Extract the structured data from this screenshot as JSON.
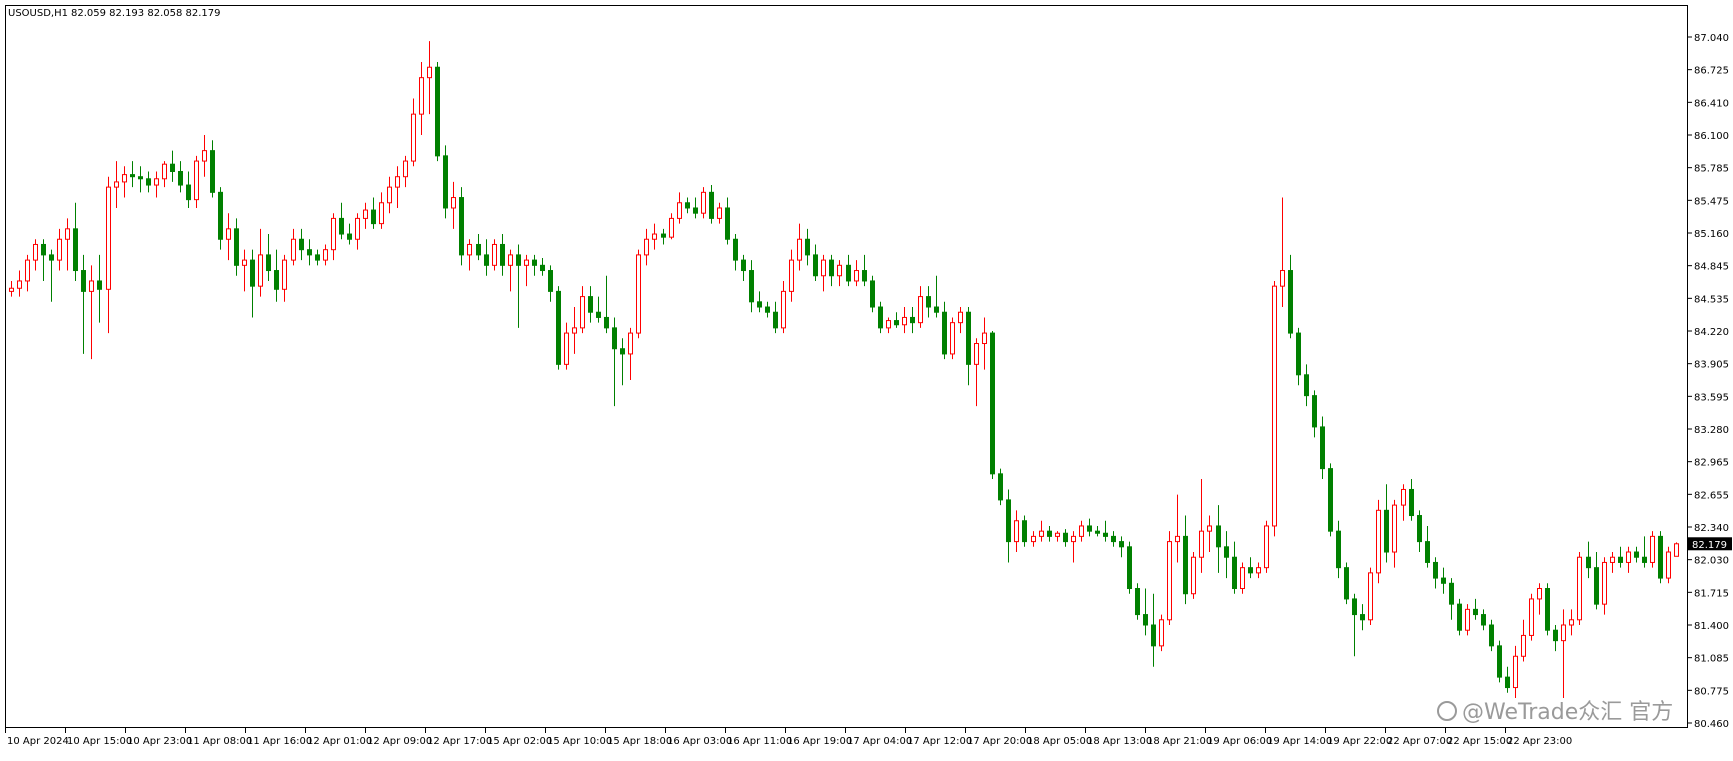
{
  "header": {
    "symbol": "USOUSD,H1",
    "ohlc": "82.059 82.193 82.058 82.179"
  },
  "watermark": {
    "text": "@WeTrade众汇 官方"
  },
  "colors": {
    "bull": "#ff0000",
    "bear": "#008000",
    "axis": "#000000",
    "price_tag_bg": "#000000",
    "price_tag_fg": "#ffffff"
  },
  "chart_data": {
    "type": "candlestick",
    "x_tick_labels": [
      "10 Apr 2024",
      "10 Apr 15:00",
      "10 Apr 23:00",
      "11 Apr 08:00",
      "11 Apr 16:00",
      "12 Apr 01:00",
      "12 Apr 09:00",
      "12 Apr 17:00",
      "15 Apr 02:00",
      "15 Apr 10:00",
      "15 Apr 18:00",
      "16 Apr 03:00",
      "16 Apr 11:00",
      "16 Apr 19:00",
      "17 Apr 04:00",
      "17 Apr 12:00",
      "17 Apr 20:00",
      "18 Apr 05:00",
      "18 Apr 13:00",
      "18 Apr 21:00",
      "19 Apr 06:00",
      "19 Apr 14:00",
      "19 Apr 22:00",
      "22 Apr 07:00",
      "22 Apr 15:00",
      "22 Apr 23:00"
    ],
    "y_tick_labels": [
      "87.040",
      "86.725",
      "86.410",
      "86.100",
      "85.785",
      "85.475",
      "85.160",
      "84.845",
      "84.535",
      "84.220",
      "83.905",
      "83.595",
      "83.280",
      "82.965",
      "82.655",
      "82.340",
      "82.030",
      "81.715",
      "81.400",
      "81.085",
      "80.775",
      "80.460"
    ],
    "ylim": [
      80.46,
      87.04
    ],
    "current_price": "82.179",
    "candles": [
      [
        84.6,
        84.7,
        84.55,
        84.63
      ],
      [
        84.63,
        84.8,
        84.55,
        84.7
      ],
      [
        84.7,
        84.95,
        84.6,
        84.9
      ],
      [
        84.9,
        85.1,
        84.8,
        85.05
      ],
      [
        85.05,
        85.1,
        84.7,
        84.95
      ],
      [
        84.95,
        85.0,
        84.5,
        84.9
      ],
      [
        84.9,
        85.2,
        84.8,
        85.1
      ],
      [
        85.1,
        85.3,
        84.8,
        85.2
      ],
      [
        85.2,
        85.45,
        84.7,
        84.8
      ],
      [
        84.8,
        84.95,
        84.0,
        84.6
      ],
      [
        84.6,
        84.85,
        83.95,
        84.7
      ],
      [
        84.7,
        84.95,
        84.3,
        84.62
      ],
      [
        84.62,
        85.7,
        84.2,
        85.6
      ],
      [
        85.6,
        85.85,
        85.4,
        85.65
      ],
      [
        85.65,
        85.8,
        85.5,
        85.72
      ],
      [
        85.72,
        85.85,
        85.6,
        85.7
      ],
      [
        85.7,
        85.8,
        85.55,
        85.68
      ],
      [
        85.68,
        85.75,
        85.55,
        85.62
      ],
      [
        85.62,
        85.75,
        85.5,
        85.68
      ],
      [
        85.68,
        85.85,
        85.6,
        85.82
      ],
      [
        85.82,
        85.95,
        85.65,
        85.75
      ],
      [
        85.75,
        85.85,
        85.55,
        85.62
      ],
      [
        85.62,
        85.75,
        85.4,
        85.48
      ],
      [
        85.48,
        85.9,
        85.4,
        85.85
      ],
      [
        85.85,
        86.1,
        85.7,
        85.95
      ],
      [
        85.95,
        86.05,
        85.5,
        85.55
      ],
      [
        85.55,
        85.6,
        85.0,
        85.1
      ],
      [
        85.1,
        85.35,
        84.9,
        85.2
      ],
      [
        85.2,
        85.3,
        84.75,
        84.85
      ],
      [
        84.85,
        85.0,
        84.6,
        84.9
      ],
      [
        84.9,
        85.0,
        84.35,
        84.65
      ],
      [
        84.65,
        85.2,
        84.55,
        84.95
      ],
      [
        84.95,
        85.15,
        84.7,
        84.8
      ],
      [
        84.8,
        85.0,
        84.5,
        84.62
      ],
      [
        84.62,
        84.95,
        84.5,
        84.9
      ],
      [
        84.9,
        85.2,
        84.85,
        85.1
      ],
      [
        85.1,
        85.2,
        84.9,
        85.0
      ],
      [
        85.0,
        85.1,
        84.85,
        84.95
      ],
      [
        84.95,
        85.0,
        84.85,
        84.9
      ],
      [
        84.9,
        85.05,
        84.85,
        85.0
      ],
      [
        85.0,
        85.35,
        84.9,
        85.3
      ],
      [
        85.3,
        85.45,
        85.1,
        85.15
      ],
      [
        85.15,
        85.25,
        85.05,
        85.1
      ],
      [
        85.1,
        85.35,
        85.0,
        85.3
      ],
      [
        85.3,
        85.45,
        85.2,
        85.38
      ],
      [
        85.38,
        85.5,
        85.2,
        85.25
      ],
      [
        85.25,
        85.55,
        85.2,
        85.45
      ],
      [
        85.45,
        85.7,
        85.35,
        85.6
      ],
      [
        85.6,
        85.8,
        85.4,
        85.7
      ],
      [
        85.7,
        85.9,
        85.6,
        85.85
      ],
      [
        85.85,
        86.45,
        85.8,
        86.3
      ],
      [
        86.3,
        86.8,
        86.1,
        86.65
      ],
      [
        86.65,
        87.0,
        86.3,
        86.75
      ],
      [
        86.75,
        86.8,
        85.85,
        85.9
      ],
      [
        85.9,
        86.0,
        85.3,
        85.4
      ],
      [
        85.4,
        85.65,
        85.2,
        85.5
      ],
      [
        85.5,
        85.6,
        84.85,
        84.95
      ],
      [
        84.95,
        85.1,
        84.8,
        85.05
      ],
      [
        85.05,
        85.15,
        84.9,
        84.95
      ],
      [
        84.95,
        85.1,
        84.75,
        84.85
      ],
      [
        84.85,
        85.1,
        84.8,
        85.05
      ],
      [
        85.05,
        85.15,
        84.75,
        84.85
      ],
      [
        84.85,
        85.0,
        84.6,
        84.95
      ],
      [
        84.95,
        85.05,
        84.25,
        84.85
      ],
      [
        84.85,
        84.95,
        84.65,
        84.9
      ],
      [
        84.9,
        84.95,
        84.75,
        84.85
      ],
      [
        84.85,
        84.92,
        84.75,
        84.8
      ],
      [
        84.8,
        84.85,
        84.5,
        84.6
      ],
      [
        84.6,
        84.65,
        83.85,
        83.9
      ],
      [
        83.9,
        84.3,
        83.85,
        84.2
      ],
      [
        84.2,
        84.45,
        84.0,
        84.25
      ],
      [
        84.25,
        84.65,
        84.2,
        84.55
      ],
      [
        84.55,
        84.65,
        84.3,
        84.4
      ],
      [
        84.4,
        84.55,
        84.3,
        84.35
      ],
      [
        84.35,
        84.75,
        84.2,
        84.25
      ],
      [
        84.25,
        84.35,
        83.5,
        84.05
      ],
      [
        84.05,
        84.15,
        83.7,
        84.0
      ],
      [
        84.0,
        84.25,
        83.75,
        84.2
      ],
      [
        84.2,
        85.0,
        84.15,
        84.95
      ],
      [
        84.95,
        85.2,
        84.85,
        85.1
      ],
      [
        85.1,
        85.25,
        85.0,
        85.15
      ],
      [
        85.15,
        85.2,
        85.05,
        85.12
      ],
      [
        85.12,
        85.35,
        85.1,
        85.3
      ],
      [
        85.3,
        85.55,
        85.25,
        85.45
      ],
      [
        85.45,
        85.5,
        85.35,
        85.4
      ],
      [
        85.4,
        85.5,
        85.3,
        85.35
      ],
      [
        85.35,
        85.6,
        85.3,
        85.55
      ],
      [
        85.55,
        85.62,
        85.25,
        85.3
      ],
      [
        85.3,
        85.45,
        85.25,
        85.4
      ],
      [
        85.4,
        85.5,
        85.05,
        85.1
      ],
      [
        85.1,
        85.15,
        84.8,
        84.9
      ],
      [
        84.9,
        84.95,
        84.7,
        84.8
      ],
      [
        84.8,
        84.9,
        84.4,
        84.5
      ],
      [
        84.5,
        84.6,
        84.4,
        84.45
      ],
      [
        84.45,
        84.5,
        84.35,
        84.4
      ],
      [
        84.4,
        84.5,
        84.2,
        84.25
      ],
      [
        84.25,
        84.7,
        84.2,
        84.6
      ],
      [
        84.6,
        85.0,
        84.5,
        84.9
      ],
      [
        84.9,
        85.25,
        84.8,
        85.1
      ],
      [
        85.1,
        85.2,
        84.85,
        84.95
      ],
      [
        84.95,
        85.05,
        84.7,
        84.75
      ],
      [
        84.75,
        84.95,
        84.6,
        84.9
      ],
      [
        84.9,
        84.95,
        84.65,
        84.75
      ],
      [
        84.75,
        84.9,
        84.65,
        84.85
      ],
      [
        84.85,
        84.95,
        84.65,
        84.7
      ],
      [
        84.7,
        84.9,
        84.65,
        84.8
      ],
      [
        84.8,
        84.95,
        84.65,
        84.7
      ],
      [
        84.7,
        84.75,
        84.4,
        84.45
      ],
      [
        84.45,
        84.5,
        84.2,
        84.25
      ],
      [
        84.25,
        84.35,
        84.2,
        84.32
      ],
      [
        84.32,
        84.4,
        84.25,
        84.28
      ],
      [
        84.28,
        84.45,
        84.2,
        84.35
      ],
      [
        84.35,
        84.45,
        84.2,
        84.3
      ],
      [
        84.3,
        84.65,
        84.25,
        84.55
      ],
      [
        84.55,
        84.65,
        84.35,
        84.45
      ],
      [
        84.45,
        84.75,
        84.35,
        84.4
      ],
      [
        84.4,
        84.5,
        83.95,
        84.0
      ],
      [
        84.0,
        84.35,
        83.95,
        84.3
      ],
      [
        84.3,
        84.45,
        84.2,
        84.4
      ],
      [
        84.4,
        84.45,
        83.7,
        83.9
      ],
      [
        83.9,
        84.15,
        83.5,
        84.1
      ],
      [
        84.1,
        84.35,
        83.85,
        84.2
      ],
      [
        84.2,
        84.22,
        82.8,
        82.85
      ],
      [
        82.85,
        82.9,
        82.55,
        82.6
      ],
      [
        82.6,
        82.7,
        82.0,
        82.2
      ],
      [
        82.2,
        82.5,
        82.1,
        82.4
      ],
      [
        82.4,
        82.45,
        82.15,
        82.2
      ],
      [
        82.2,
        82.3,
        82.15,
        82.25
      ],
      [
        82.25,
        82.4,
        82.2,
        82.3
      ],
      [
        82.3,
        82.35,
        82.2,
        82.25
      ],
      [
        82.25,
        82.3,
        82.2,
        82.28
      ],
      [
        82.28,
        82.32,
        82.15,
        82.2
      ],
      [
        82.2,
        82.3,
        82.0,
        82.25
      ],
      [
        82.25,
        82.4,
        82.2,
        82.35
      ],
      [
        82.35,
        82.42,
        82.25,
        82.3
      ],
      [
        82.3,
        82.35,
        82.25,
        82.28
      ],
      [
        82.28,
        82.4,
        82.2,
        82.25
      ],
      [
        82.25,
        82.3,
        82.15,
        82.2
      ],
      [
        82.2,
        82.25,
        82.05,
        82.15
      ],
      [
        82.15,
        82.2,
        81.7,
        81.75
      ],
      [
        81.75,
        81.8,
        81.45,
        81.5
      ],
      [
        81.5,
        81.75,
        81.3,
        81.4
      ],
      [
        81.4,
        81.7,
        81.0,
        81.2
      ],
      [
        81.2,
        81.5,
        81.15,
        81.45
      ],
      [
        81.45,
        82.3,
        81.4,
        82.2
      ],
      [
        82.2,
        82.65,
        82.0,
        82.25
      ],
      [
        82.25,
        82.45,
        81.6,
        81.7
      ],
      [
        81.7,
        82.1,
        81.65,
        82.05
      ],
      [
        82.05,
        82.8,
        81.9,
        82.3
      ],
      [
        82.3,
        82.45,
        82.1,
        82.35
      ],
      [
        82.35,
        82.55,
        81.9,
        82.15
      ],
      [
        82.15,
        82.3,
        81.85,
        82.05
      ],
      [
        82.05,
        82.2,
        81.7,
        81.75
      ],
      [
        81.75,
        82.0,
        81.7,
        81.95
      ],
      [
        81.95,
        82.05,
        81.85,
        81.9
      ],
      [
        81.9,
        82.0,
        81.85,
        81.95
      ],
      [
        81.95,
        82.4,
        81.9,
        82.35
      ],
      [
        82.35,
        84.7,
        82.25,
        84.65
      ],
      [
        84.65,
        85.5,
        84.45,
        84.8
      ],
      [
        84.8,
        84.95,
        84.15,
        84.2
      ],
      [
        84.2,
        84.25,
        83.7,
        83.8
      ],
      [
        83.8,
        83.9,
        83.5,
        83.6
      ],
      [
        83.6,
        83.65,
        83.2,
        83.3
      ],
      [
        83.3,
        83.4,
        82.8,
        82.9
      ],
      [
        82.9,
        82.95,
        82.25,
        82.3
      ],
      [
        82.3,
        82.4,
        81.85,
        81.95
      ],
      [
        81.95,
        82.0,
        81.6,
        81.65
      ],
      [
        81.65,
        81.7,
        81.1,
        81.5
      ],
      [
        81.5,
        81.6,
        81.35,
        81.45
      ],
      [
        81.45,
        81.95,
        81.4,
        81.9
      ],
      [
        81.9,
        82.6,
        81.8,
        82.5
      ],
      [
        82.5,
        82.75,
        82.0,
        82.1
      ],
      [
        82.1,
        82.6,
        81.95,
        82.55
      ],
      [
        82.55,
        82.75,
        82.4,
        82.7
      ],
      [
        82.7,
        82.8,
        82.4,
        82.45
      ],
      [
        82.45,
        82.5,
        82.1,
        82.2
      ],
      [
        82.2,
        82.35,
        81.95,
        82.0
      ],
      [
        82.0,
        82.05,
        81.75,
        81.85
      ],
      [
        81.85,
        81.95,
        81.7,
        81.8
      ],
      [
        81.8,
        81.85,
        81.45,
        81.6
      ],
      [
        81.6,
        81.65,
        81.3,
        81.35
      ],
      [
        81.35,
        81.6,
        81.3,
        81.55
      ],
      [
        81.55,
        81.65,
        81.45,
        81.5
      ],
      [
        81.5,
        81.55,
        81.35,
        81.4
      ],
      [
        81.4,
        81.45,
        81.15,
        81.2
      ],
      [
        81.2,
        81.25,
        80.85,
        80.9
      ],
      [
        80.9,
        81.0,
        80.75,
        80.8
      ],
      [
        80.8,
        81.2,
        80.7,
        81.1
      ],
      [
        81.1,
        81.45,
        81.05,
        81.3
      ],
      [
        81.3,
        81.7,
        81.25,
        81.65
      ],
      [
        81.65,
        81.8,
        81.5,
        81.75
      ],
      [
        81.75,
        81.8,
        81.3,
        81.35
      ],
      [
        81.35,
        81.4,
        81.15,
        81.25
      ],
      [
        81.25,
        81.55,
        80.7,
        81.4
      ],
      [
        81.4,
        81.55,
        81.3,
        81.45
      ],
      [
        81.45,
        82.1,
        81.4,
        82.05
      ],
      [
        82.05,
        82.2,
        81.85,
        81.95
      ],
      [
        81.95,
        82.1,
        81.55,
        81.6
      ],
      [
        81.6,
        82.05,
        81.5,
        82.0
      ],
      [
        82.0,
        82.1,
        81.9,
        82.05
      ],
      [
        82.05,
        82.15,
        81.95,
        82.0
      ],
      [
        82.0,
        82.15,
        81.9,
        82.1
      ],
      [
        82.1,
        82.15,
        82.0,
        82.05
      ],
      [
        82.05,
        82.25,
        81.95,
        82.0
      ],
      [
        82.0,
        82.3,
        81.95,
        82.25
      ],
      [
        82.25,
        82.3,
        81.8,
        81.85
      ],
      [
        81.85,
        82.15,
        81.8,
        82.1
      ],
      [
        82.059,
        82.193,
        82.058,
        82.179
      ]
    ]
  }
}
